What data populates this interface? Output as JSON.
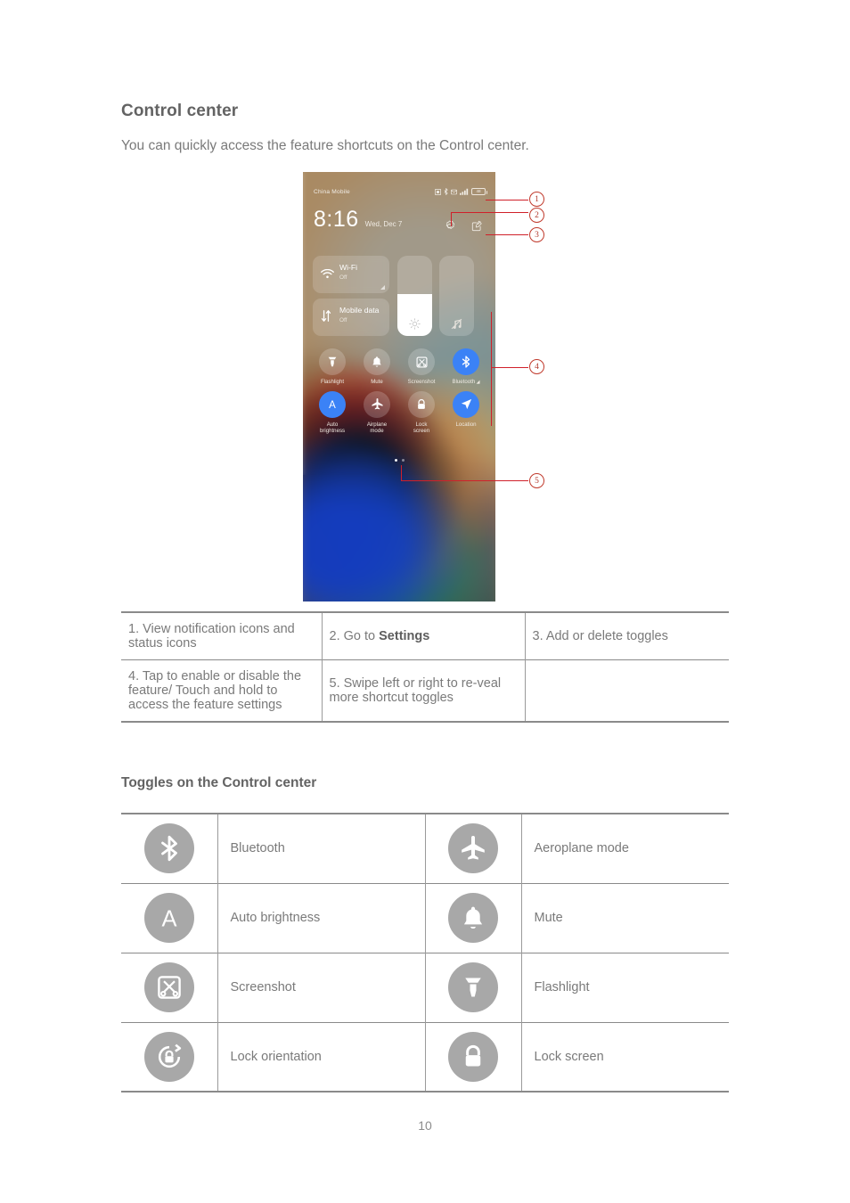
{
  "doc": {
    "heading": "Control center",
    "intro": "You can quickly access the feature shortcuts on the Control center.",
    "subheading": "Toggles on the Control center",
    "page_number": "10"
  },
  "phone": {
    "status_bar": {
      "carrier": "China Mobile",
      "battery_level": "48",
      "icons": [
        "notification-icon",
        "bluetooth-icon",
        "mail-icon",
        "signal-bars-icon",
        "battery-icon"
      ]
    },
    "clock": "8:16",
    "date": "Wed, Dec 7",
    "top_actions": [
      {
        "name": "settings-gear-icon",
        "label": "Settings"
      },
      {
        "name": "edit-toggles-icon",
        "label": "Edit"
      }
    ],
    "cards": [
      {
        "title": "Wi-Fi",
        "status": "Off",
        "icon": "wifi-icon"
      },
      {
        "title": "Mobile data",
        "status": "Off",
        "icon": "mobile-data-icon"
      }
    ],
    "sliders": [
      {
        "name": "brightness-slider",
        "icon": "brightness-icon",
        "value": 52
      },
      {
        "name": "volume-slider",
        "icon": "volume-muted-icon",
        "value": 0
      }
    ],
    "toggles_row1": [
      {
        "label": "Flashlight",
        "icon": "flashlight-icon",
        "active": false
      },
      {
        "label": "Mute",
        "icon": "bell-icon",
        "active": false
      },
      {
        "label": "Screenshot",
        "icon": "screenshot-icon",
        "active": false
      },
      {
        "label": "Bluetooth",
        "icon": "bluetooth-icon",
        "active": true,
        "arrow": true
      }
    ],
    "toggles_row2": [
      {
        "label": "Auto\nbrightness",
        "icon": "auto-brightness-icon",
        "active": true
      },
      {
        "label": "Airplane\nmode",
        "icon": "airplane-icon",
        "active": false
      },
      {
        "label": "Lock\nscreen",
        "icon": "lock-icon",
        "active": false
      },
      {
        "label": "Location",
        "icon": "location-icon",
        "active": true
      }
    ],
    "page_dots": [
      "active",
      "inactive"
    ]
  },
  "callouts": [
    {
      "number": "1"
    },
    {
      "number": "2"
    },
    {
      "number": "3"
    },
    {
      "number": "4"
    },
    {
      "number": "5"
    }
  ],
  "steps_table": {
    "rows": [
      [
        {
          "text": "1. View notification icons and status icons"
        },
        {
          "text_prefix": "2. Go to ",
          "text_bold": "Settings"
        },
        {
          "text": "3. Add or delete toggles"
        }
      ],
      [
        {
          "text": "4. Tap to enable or disable the feature/ Touch and hold to access the feature settings"
        },
        {
          "text": "5. Swipe left or right to re-veal more shortcut toggles"
        },
        {
          "text": ""
        }
      ]
    ]
  },
  "toggles_table": {
    "rows": [
      [
        {
          "icon": "bluetooth-icon",
          "label": "Bluetooth"
        },
        {
          "icon": "airplane-icon",
          "label": "Aeroplane mode"
        }
      ],
      [
        {
          "icon": "auto-brightness-icon",
          "label": "Auto brightness"
        },
        {
          "icon": "bell-icon",
          "label": "Mute"
        }
      ],
      [
        {
          "icon": "screenshot-icon",
          "label": "Screenshot"
        },
        {
          "icon": "flashlight-icon",
          "label": "Flashlight"
        }
      ],
      [
        {
          "icon": "lock-orientation-icon",
          "label": "Lock orientation"
        },
        {
          "icon": "lock-icon",
          "label": "Lock screen"
        }
      ]
    ]
  },
  "colors": {
    "accent_blue": "#3b82f6",
    "callout_red": "#d0202a",
    "icon_gray": "#a8a8a8",
    "text_gray": "#7a7a7a"
  }
}
